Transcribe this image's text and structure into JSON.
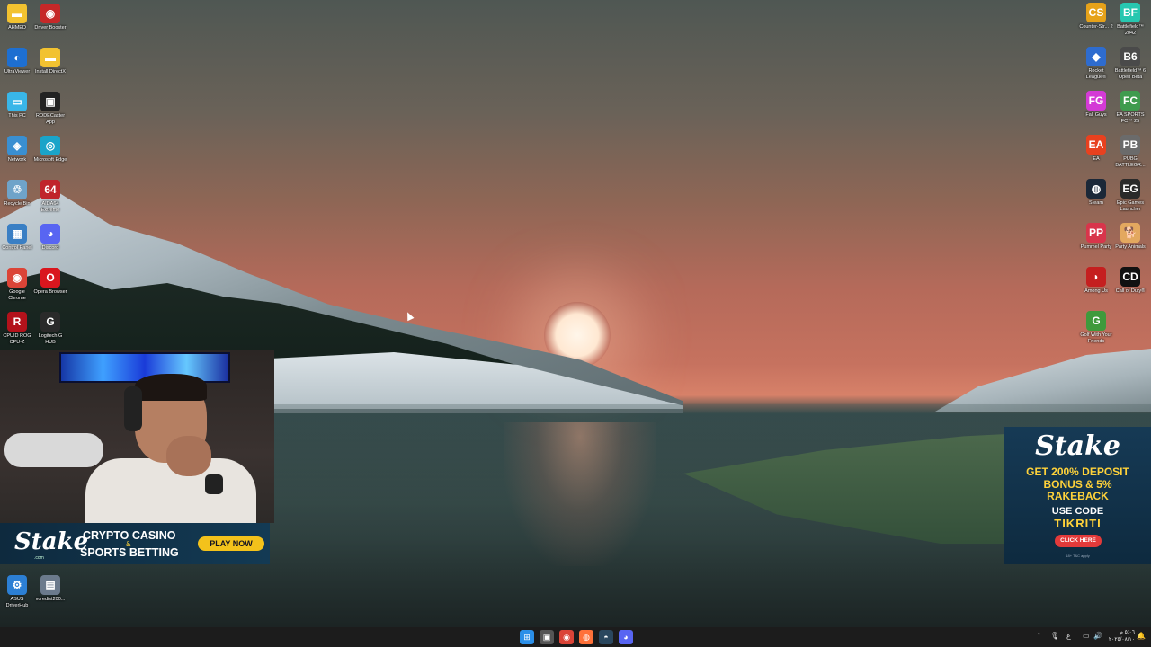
{
  "desktop_icons_left": [
    {
      "label": "AHMED",
      "glyph": "▬",
      "color": "#f2c230"
    },
    {
      "label": "Driver Booster",
      "glyph": "◉",
      "color": "#c62828"
    },
    {
      "label": "UltraViewer",
      "glyph": "◐",
      "color": "#1e6fd1"
    },
    {
      "label": "Install DirectX",
      "glyph": "▬",
      "color": "#f2c230"
    },
    {
      "label": "This PC",
      "glyph": "▭",
      "color": "#39b6e8"
    },
    {
      "label": "RODECaster App",
      "glyph": "▣",
      "color": "#222222"
    },
    {
      "label": "Network",
      "glyph": "◈",
      "color": "#3a8fd1"
    },
    {
      "label": "Microsoft Edge",
      "glyph": "◎",
      "color": "#1aa4c9"
    },
    {
      "label": "Recycle Bin",
      "glyph": "♲",
      "color": "#6fa3c9"
    },
    {
      "label": "AIDA64 Extreme",
      "glyph": "64",
      "color": "#c0242b"
    },
    {
      "label": "Control Panel",
      "glyph": "▦",
      "color": "#3a7fc4"
    },
    {
      "label": "Discord",
      "glyph": "◕",
      "color": "#5865f2"
    },
    {
      "label": "Google Chrome",
      "glyph": "◉",
      "color": "#db4437"
    },
    {
      "label": "Opera Browser",
      "glyph": "O",
      "color": "#d9161e"
    },
    {
      "label": "CPUID ROG CPU-Z",
      "glyph": "R",
      "color": "#b3121b"
    },
    {
      "label": "Logitech G HUB",
      "glyph": "G",
      "color": "#2a2a2a"
    },
    {
      "label": "ASUS DriverHub",
      "glyph": "⚙",
      "color": "#2c7fd4"
    },
    {
      "label": "vcredist200...",
      "glyph": "▤",
      "color": "#6b7a8c"
    }
  ],
  "desktop_icons_right": [
    {
      "label": "Counter-Str... 2",
      "glyph": "CS",
      "color": "#e6a21a"
    },
    {
      "label": "Battlefield™ 2042",
      "glyph": "BF",
      "color": "#27c7b0"
    },
    {
      "label": "Rocket League®",
      "glyph": "◆",
      "color": "#2e6ccf"
    },
    {
      "label": "Battlefield™ 6 Open Beta",
      "glyph": "B6",
      "color": "#4a4a4a"
    },
    {
      "label": "Fall Guys",
      "glyph": "FG",
      "color": "#d43ad6"
    },
    {
      "label": "EA SPORTS FC™ 25",
      "glyph": "FC",
      "color": "#3f9b4e"
    },
    {
      "label": "EA",
      "glyph": "EA",
      "color": "#e8411f"
    },
    {
      "label": "PUBG BATTLEGR...",
      "glyph": "PB",
      "color": "#6b6b6b"
    },
    {
      "label": "Steam",
      "glyph": "◍",
      "color": "#1b2838"
    },
    {
      "label": "Epic Games Launcher",
      "glyph": "EG",
      "color": "#2a2a2a"
    },
    {
      "label": "Pummel Party",
      "glyph": "PP",
      "color": "#d8354b"
    },
    {
      "label": "Party Animals",
      "glyph": "🐕",
      "color": "#e3a85f"
    },
    {
      "label": "Among Us",
      "glyph": "◗",
      "color": "#c51f1f"
    },
    {
      "label": "Call of Duty®",
      "glyph": "CD",
      "color": "#111111"
    },
    {
      "label": "Golf With Your Friends",
      "glyph": "G",
      "color": "#3f9a3c"
    }
  ],
  "stake_banner": {
    "logo": "Stake",
    "sub": ".com",
    "line1": "CRYPTO CASINO",
    "amp": "&",
    "line2": "SPORTS BETTING",
    "play": "PLAY NOW"
  },
  "stake_ad": {
    "logo": "Stake",
    "line1": "GET 200% DEPOSIT",
    "line2": "BONUS & 5%",
    "line3": "RAKEBACK",
    "use": "USE CODE",
    "code": "TIKRITI",
    "click": "CLICK HERE",
    "fine": "18+ T&C apply"
  },
  "taskbar": {
    "apps": [
      {
        "name": "start-icon",
        "glyph": "⊞",
        "color": "#2b8fe8"
      },
      {
        "name": "task-view-icon",
        "glyph": "▣",
        "color": "#555555"
      },
      {
        "name": "chrome-icon",
        "glyph": "◉",
        "color": "#db4437"
      },
      {
        "name": "firefox-icon",
        "glyph": "◍",
        "color": "#ff7139"
      },
      {
        "name": "steam-icon",
        "glyph": "◓",
        "color": "#2a475e"
      },
      {
        "name": "discord-icon",
        "glyph": "◕",
        "color": "#5865f2"
      }
    ],
    "clock_time": "٥:٠٦ م",
    "clock_date": "٢٠٢٥/٠٨/١٠"
  }
}
